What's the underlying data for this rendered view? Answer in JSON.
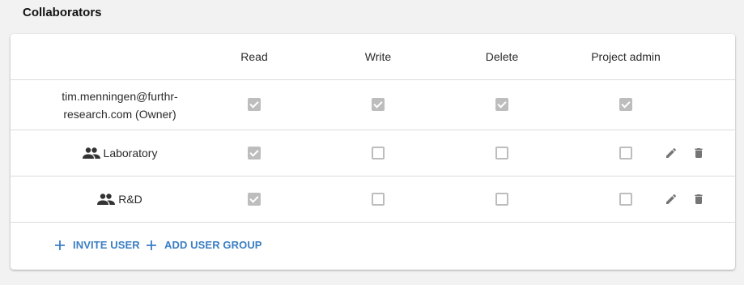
{
  "section": {
    "title": "Collaborators"
  },
  "columns": [
    "Read",
    "Write",
    "Delete",
    "Project admin"
  ],
  "rows": [
    {
      "name": "tim.menningen@furthr-research.com (Owner)",
      "type": "user",
      "read": true,
      "write": true,
      "delete": true,
      "admin": true,
      "editable": false
    },
    {
      "name": "Laboratory",
      "type": "group",
      "read": true,
      "write": false,
      "delete": false,
      "admin": false,
      "editable": true
    },
    {
      "name": "R&D",
      "type": "group",
      "read": true,
      "write": false,
      "delete": false,
      "admin": false,
      "editable": true
    }
  ],
  "footer": {
    "invite_label": "INVITE USER",
    "add_group_label": "ADD USER GROUP"
  },
  "colors": {
    "accent": "#3a7ec4",
    "checkbox_disabled": "#bdbdbd",
    "icon": "#757575"
  },
  "icons": {
    "group": "group-icon",
    "edit": "pencil-icon",
    "delete": "trash-icon",
    "add": "plus-icon"
  }
}
